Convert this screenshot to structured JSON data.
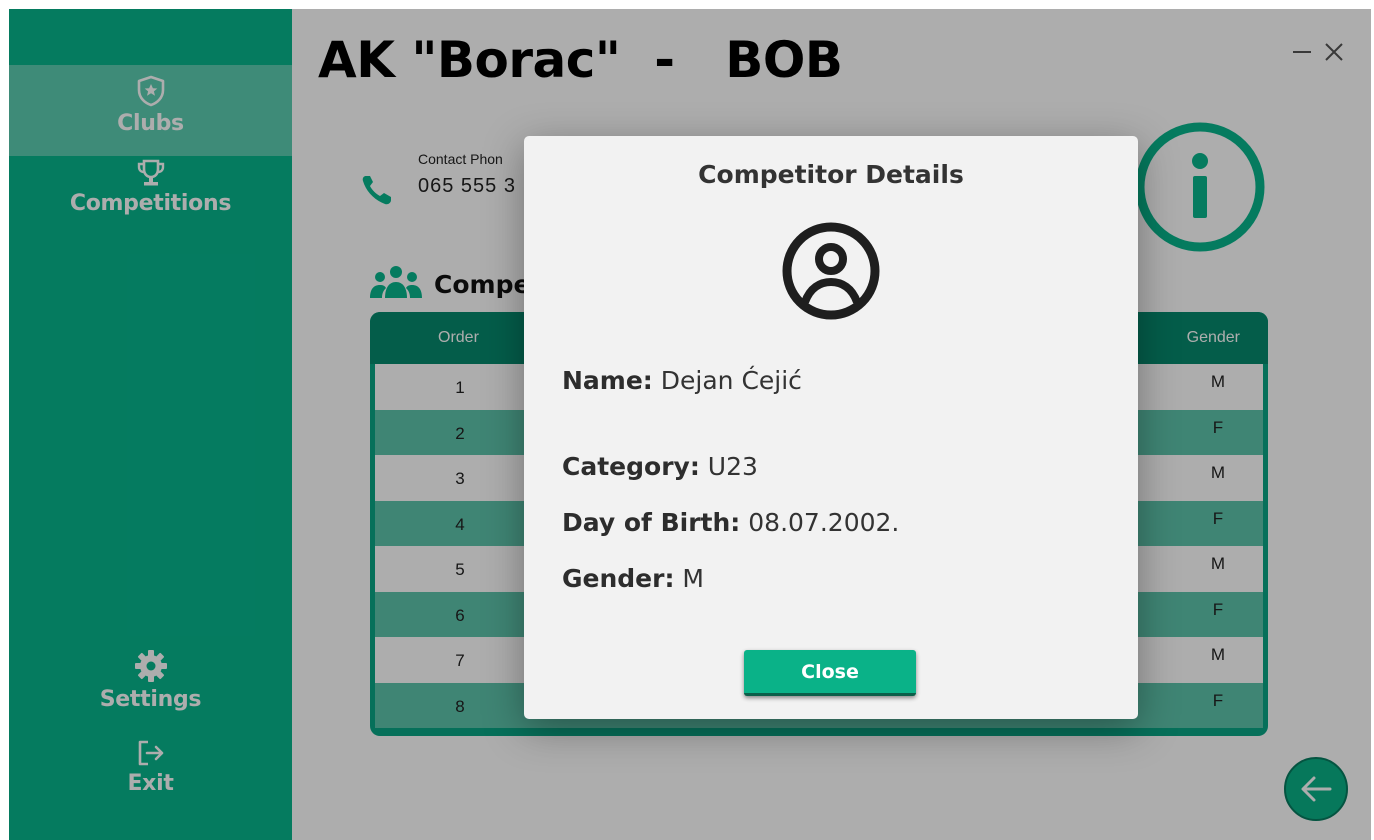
{
  "app": {
    "club_title": "AK \"Borac\"  -   BOB",
    "accent_color": "#08b68d"
  },
  "sidebar": {
    "items": [
      {
        "label": "Clubs",
        "icon": "shield-star-icon",
        "active": true
      },
      {
        "label": "Competitions",
        "icon": "trophy-icon",
        "active": false
      },
      {
        "label": "Settings",
        "icon": "gear-icon",
        "active": false
      },
      {
        "label": "Exit",
        "icon": "exit-icon",
        "active": false
      }
    ]
  },
  "window_controls": {
    "minimize": "—",
    "close": "✕"
  },
  "contact": {
    "label": "Contact Phon",
    "value": "065 555 3"
  },
  "section": {
    "title": "Compe",
    "icon": "people-group-icon"
  },
  "table": {
    "columns": {
      "order": "Order",
      "gender": "Gender"
    },
    "rows": [
      {
        "order": "1",
        "gender": "M"
      },
      {
        "order": "2",
        "gender": "F"
      },
      {
        "order": "3",
        "gender": "M"
      },
      {
        "order": "4",
        "gender": "F"
      },
      {
        "order": "5",
        "gender": "M"
      },
      {
        "order": "6",
        "gender": "F"
      },
      {
        "order": "7",
        "gender": "M"
      },
      {
        "order": "8",
        "gender": "F"
      }
    ]
  },
  "dialog": {
    "title": "Competitor Details",
    "name_label": "Name:",
    "name_value": "Dejan Ćejić",
    "category_label": "Category:",
    "category_value": "U23",
    "dob_label": "Day of Birth:",
    "dob_value": "08.07.2002.",
    "gender_label": "Gender:",
    "gender_value": "M",
    "close_label": "Close"
  }
}
